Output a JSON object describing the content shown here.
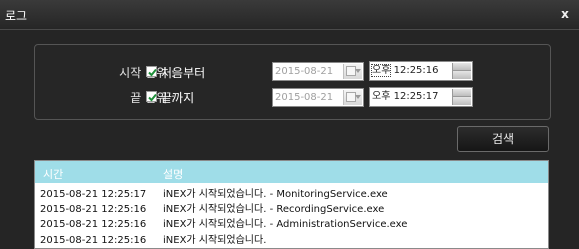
{
  "window": {
    "title": "로그",
    "close_label": "x"
  },
  "filter": {
    "start": {
      "label": "시작 범위 :",
      "checked": true,
      "checkbox_label": "처음부터",
      "date": "2015-08-21",
      "time_period": "오후",
      "time": "12:25:16"
    },
    "end": {
      "label": "끝 범위 :",
      "checked": true,
      "checkbox_label": "끝까지",
      "date": "2015-08-21",
      "time_period": "오후",
      "time": "12:25:17"
    }
  },
  "search_button_label": "검색",
  "log": {
    "columns": [
      "시간",
      "설명"
    ],
    "rows": [
      {
        "time": "2015-08-21 12:25:17",
        "desc": "iNEX가 시작되었습니다. - MonitoringService.exe"
      },
      {
        "time": "2015-08-21 12:25:16",
        "desc": "iNEX가 시작되었습니다. - RecordingService.exe"
      },
      {
        "time": "2015-08-21 12:25:16",
        "desc": "iNEX가 시작되었습니다. - AdministrationService.exe"
      },
      {
        "time": "2015-08-21 12:25:16",
        "desc": "iNEX가 시작되었습니다."
      }
    ]
  },
  "colors": {
    "header_bg": "#9fdde8",
    "checkbox_check": "#1f8f3a"
  }
}
